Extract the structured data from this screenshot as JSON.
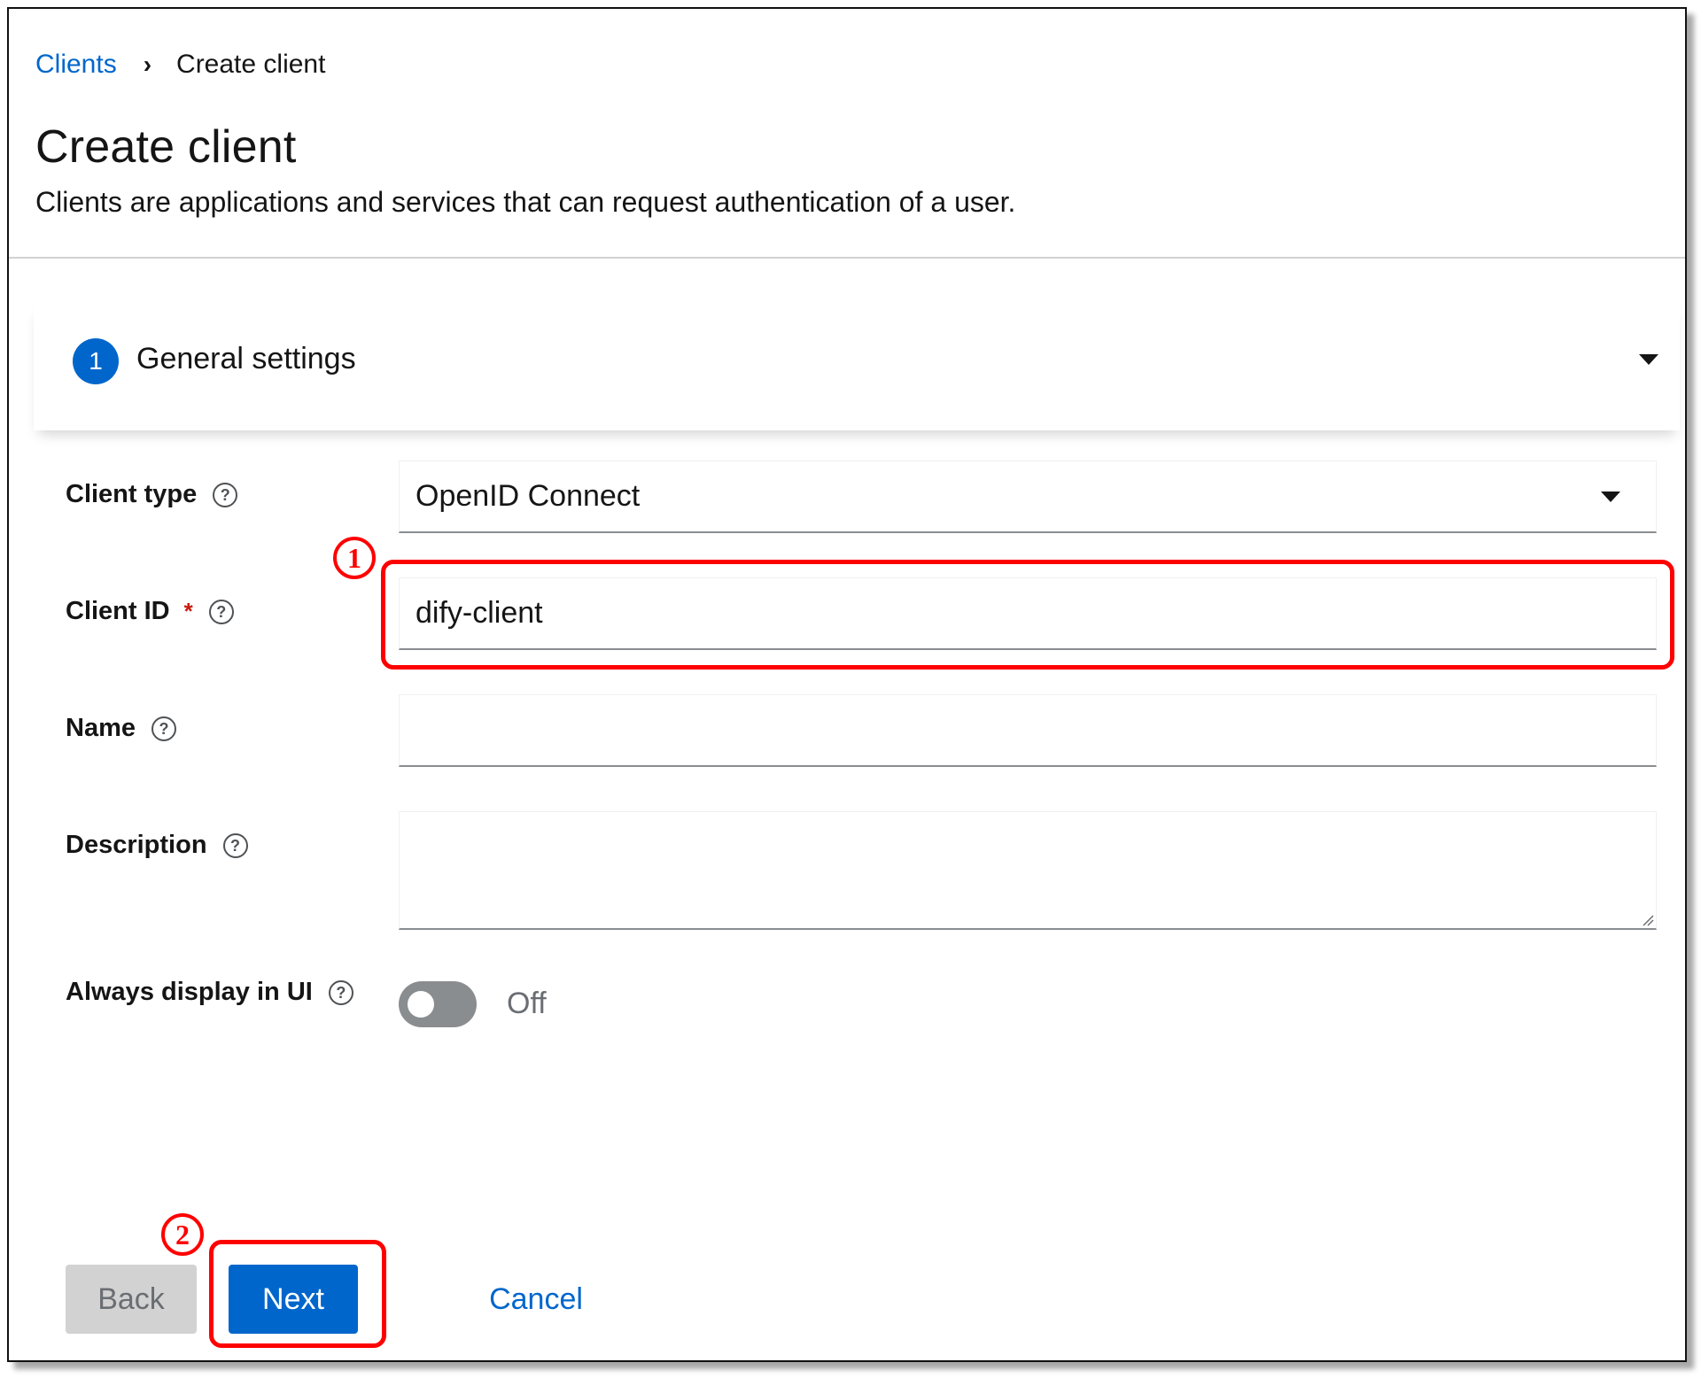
{
  "breadcrumb": {
    "parent": "Clients",
    "separator": "›",
    "current": "Create client"
  },
  "header": {
    "title": "Create client",
    "description": "Clients are applications and services that can request authentication of a user."
  },
  "step": {
    "number": "1",
    "title": "General settings"
  },
  "form": {
    "client_type": {
      "label": "Client type",
      "value": "OpenID Connect"
    },
    "client_id": {
      "label": "Client ID",
      "required_mark": "*",
      "value": "dify-client"
    },
    "name": {
      "label": "Name",
      "value": ""
    },
    "description": {
      "label": "Description",
      "value": ""
    },
    "always_display": {
      "label": "Always display in UI",
      "state_text": "Off"
    },
    "help_glyph": "?"
  },
  "buttons": {
    "back": "Back",
    "next": "Next",
    "cancel": "Cancel"
  },
  "annotations": {
    "first": "1",
    "second": "2"
  },
  "colors": {
    "link": "#0066cc",
    "primary": "#0066cc",
    "annotation": "#ff0000",
    "required": "#c9190b",
    "toggle_off": "#8a8d90"
  },
  "icons": {
    "breadcrumb_separator": "chevron-right-icon",
    "step_toggle": "caret-down-icon",
    "help": "help-circle-icon",
    "select": "caret-down-icon"
  }
}
